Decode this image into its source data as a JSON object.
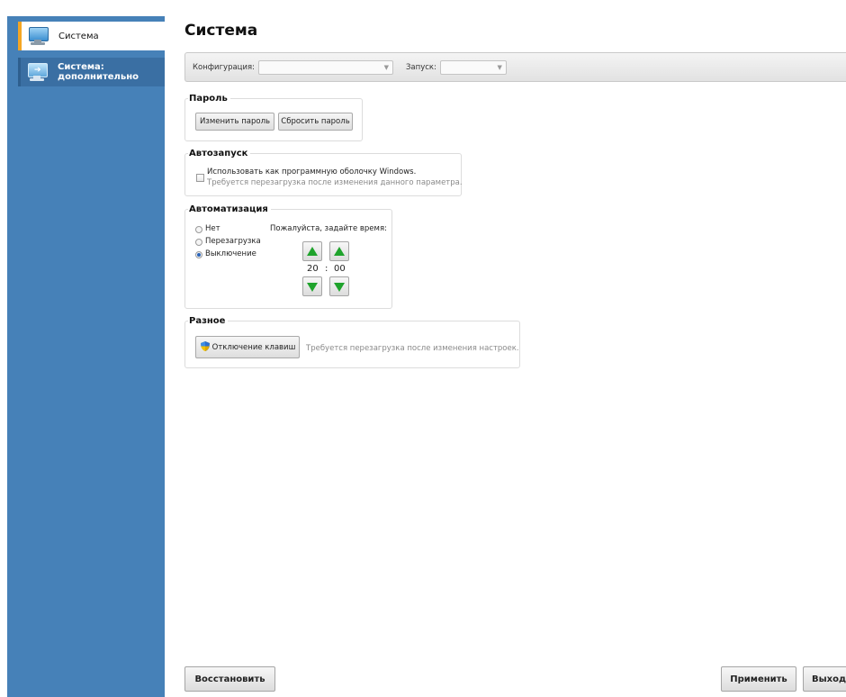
{
  "sidebar": {
    "items": [
      {
        "label": "Система",
        "icon": "monitor-icon"
      },
      {
        "label_line1": "Система:",
        "label_line2": "дополнительно",
        "icon": "monitor-arrow-icon"
      }
    ]
  },
  "page_title": "Система",
  "toolbar": {
    "config_label": "Конфигурация:",
    "config_value": "",
    "launch_label": "Запуск:",
    "launch_value": ""
  },
  "password": {
    "legend": "Пароль",
    "change_label": "Изменить пароль",
    "reset_label": "Сбросить пароль"
  },
  "autostart": {
    "legend": "Автозапуск",
    "checkbox_label": "Использовать как программную оболочку Windows.",
    "hint": "Требуется перезагрузка после изменения данного параметра.",
    "checked": false
  },
  "automation": {
    "legend": "Автоматизация",
    "options": [
      "Нет",
      "Перезагрузка",
      "Выключение"
    ],
    "selected": "Выключение",
    "time_prompt": "Пожалуйста, задайте время:",
    "hours": "20",
    "separator": ":",
    "minutes": "00"
  },
  "misc": {
    "legend": "Разное",
    "keys_button_label": "Отключение клавиш",
    "hint": "Требуется перезагрузка после изменения настроек."
  },
  "footer": {
    "restore_label": "Восстановить",
    "apply_label": "Применить",
    "exit_label": "Выход"
  },
  "colors": {
    "sidebar_bg": "#4681b8",
    "active_marker": "#f5a623",
    "arrow_green": "#1fa32c"
  }
}
